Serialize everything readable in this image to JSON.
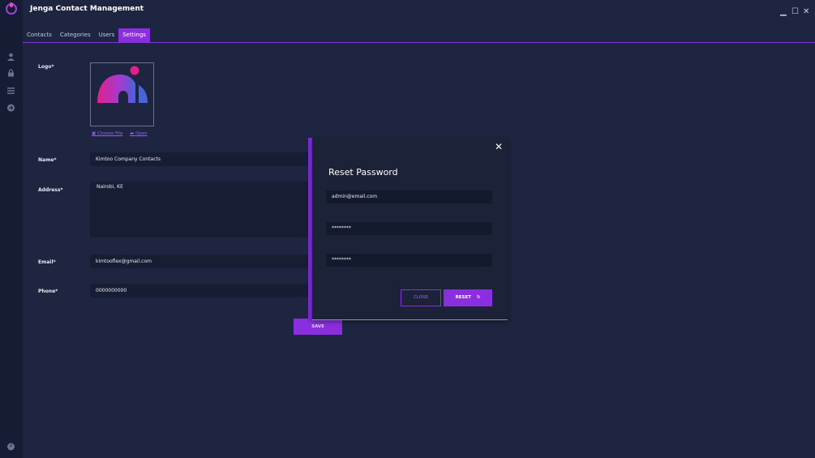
{
  "window": {
    "title": "Jenga Contact Management",
    "controls": {
      "minimize": "▁",
      "maximize": "☐",
      "close": "✕"
    }
  },
  "tabs": [
    {
      "label": "Contacts"
    },
    {
      "label": "Categories"
    },
    {
      "label": "Users"
    },
    {
      "label": "Settings",
      "active": true
    }
  ],
  "sidebar": {
    "icons": [
      "user-icon",
      "lock-icon",
      "list-icon",
      "logout-icon",
      "power-icon"
    ]
  },
  "form": {
    "logo_label": "Logo*",
    "choose_file": "Choose File",
    "open": "Open",
    "name_label": "Name*",
    "name_value": "Kimtoo Company Contacts",
    "address_label": "Address*",
    "address_value": "Nairobi, KE",
    "email_label": "Email*",
    "email_value": "kimtooflex@gmail.com",
    "phone_label": "Phone*",
    "phone_value": "0000000000",
    "save_label": "SAVE"
  },
  "modal": {
    "title": "Reset Password",
    "email_value": "admin@email.com",
    "password_value": "********",
    "confirm_value": "********",
    "close_label": "CLOSE",
    "reset_label": "RESET",
    "close_icon": "✕"
  },
  "colors": {
    "accent": "#8a2ee0",
    "background": "#1e2540",
    "sidebar": "#161c33"
  }
}
